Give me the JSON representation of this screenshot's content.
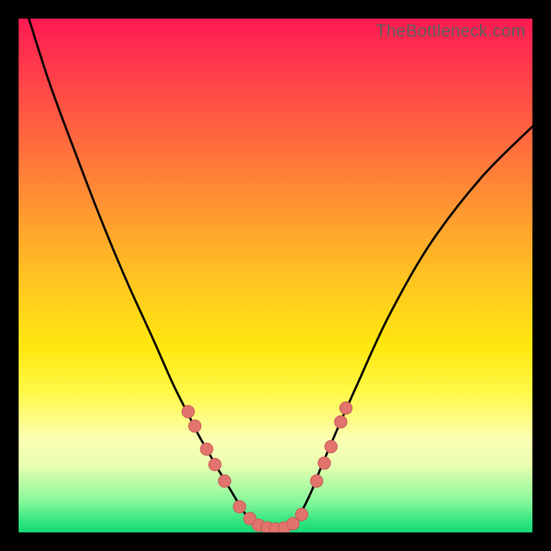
{
  "watermark": "TheBottleneck.com",
  "colors": {
    "background_black": "#000000",
    "curve": "#000000",
    "marker_fill": "#e2746e",
    "marker_stroke": "#c85a56",
    "gradient_top": "#ff1a52",
    "gradient_bottom": "#19d974"
  },
  "chart_data": {
    "type": "line",
    "title": "",
    "xlabel": "",
    "ylabel": "",
    "xlim": [
      0,
      100
    ],
    "ylim": [
      0,
      100
    ],
    "note": "Axes are unlabeled in the source image; x/y use 0–100 relative units. y is inverted so 0 = chart top, 100 = chart bottom (as rendered).",
    "series": [
      {
        "name": "bottleneck-curve",
        "x": [
          2,
          6,
          11,
          16,
          21,
          26,
          30,
          33,
          35,
          37,
          39,
          40.5,
          42,
          43.5,
          45,
          47,
          50,
          53,
          55,
          57,
          59,
          62,
          66,
          72,
          80,
          90,
          100
        ],
        "y": [
          0,
          12.5,
          26,
          39,
          51,
          62,
          71,
          77,
          81,
          84.5,
          88,
          90.5,
          93,
          95.5,
          97.5,
          99,
          99.5,
          98.5,
          96,
          92,
          87,
          80,
          71,
          58,
          44,
          31,
          21
        ]
      }
    ],
    "markers": [
      {
        "x": 33.0,
        "y": 76.5,
        "r": 9
      },
      {
        "x": 34.3,
        "y": 79.3,
        "r": 9
      },
      {
        "x": 36.6,
        "y": 83.8,
        "r": 9
      },
      {
        "x": 38.2,
        "y": 86.8,
        "r": 9
      },
      {
        "x": 40.1,
        "y": 90.0,
        "r": 9
      },
      {
        "x": 43.0,
        "y": 95.0,
        "r": 9
      },
      {
        "x": 45.0,
        "y": 97.3,
        "r": 9
      },
      {
        "x": 46.7,
        "y": 98.6,
        "r": 9
      },
      {
        "x": 48.4,
        "y": 99.1,
        "r": 9
      },
      {
        "x": 50.0,
        "y": 99.3,
        "r": 9
      },
      {
        "x": 51.7,
        "y": 99.1,
        "r": 9
      },
      {
        "x": 53.4,
        "y": 98.3,
        "r": 9
      },
      {
        "x": 55.1,
        "y": 96.5,
        "r": 9
      },
      {
        "x": 58.0,
        "y": 90.0,
        "r": 9
      },
      {
        "x": 59.5,
        "y": 86.5,
        "r": 9
      },
      {
        "x": 60.8,
        "y": 83.3,
        "r": 9
      },
      {
        "x": 62.7,
        "y": 78.5,
        "r": 9
      },
      {
        "x": 63.7,
        "y": 75.8,
        "r": 9
      }
    ]
  }
}
